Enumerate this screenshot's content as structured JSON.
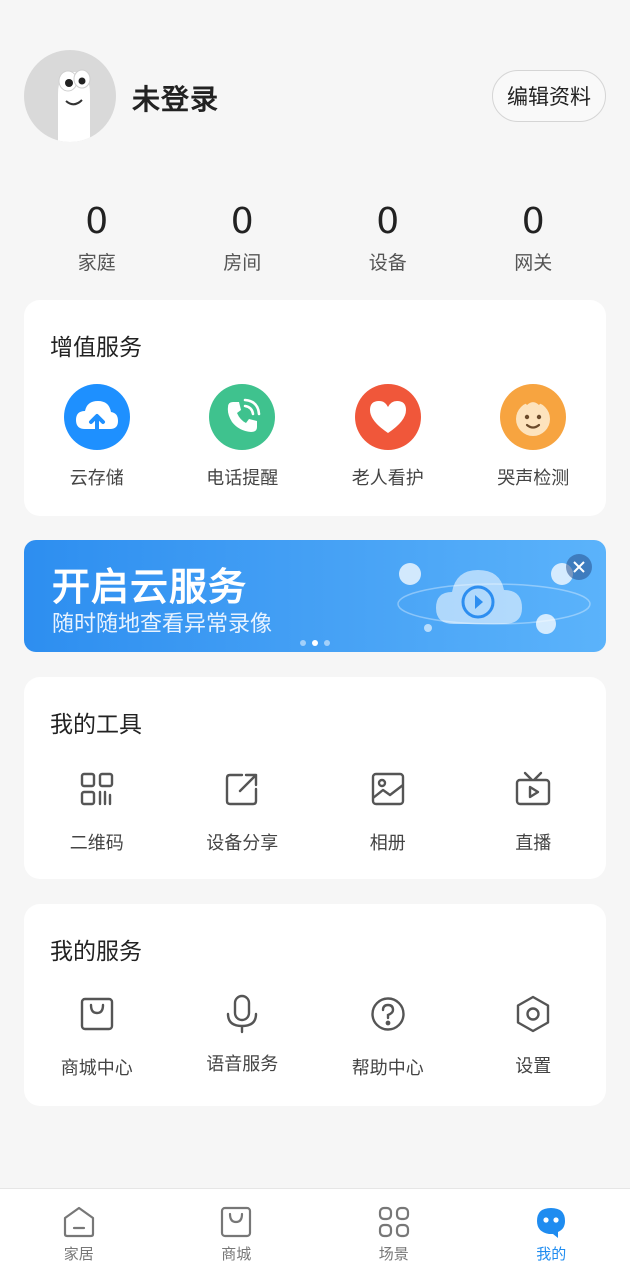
{
  "profile": {
    "username": "未登录",
    "edit_label": "编辑资料",
    "avatar_icon": "ghost-avatar-icon"
  },
  "stats": [
    {
      "value": "0",
      "label": "家庭"
    },
    {
      "value": "0",
      "label": "房间"
    },
    {
      "value": "0",
      "label": "设备"
    },
    {
      "value": "0",
      "label": "网关"
    }
  ],
  "value_services": {
    "title": "增值服务",
    "items": [
      {
        "label": "云存储",
        "icon": "cloud-upload-icon",
        "color": "#1e90ff"
      },
      {
        "label": "电话提醒",
        "icon": "phone-icon",
        "color": "#3fc28e"
      },
      {
        "label": "老人看护",
        "icon": "heart-icon",
        "color": "#f0573a"
      },
      {
        "label": "哭声检测",
        "icon": "baby-face-icon",
        "color": "#f7a440"
      }
    ]
  },
  "banner": {
    "title": "开启云服务",
    "subtitle": "随时随地查看异常录像",
    "accent": "#2d8ef0"
  },
  "tools": {
    "title": "我的工具",
    "items": [
      {
        "label": "二维码",
        "icon": "qrcode-icon"
      },
      {
        "label": "设备分享",
        "icon": "share-icon"
      },
      {
        "label": "相册",
        "icon": "album-icon"
      },
      {
        "label": "直播",
        "icon": "live-tv-icon"
      }
    ]
  },
  "services": {
    "title": "我的服务",
    "items": [
      {
        "label": "商城中心",
        "icon": "shopping-bag-icon"
      },
      {
        "label": "语音服务",
        "icon": "microphone-icon"
      },
      {
        "label": "帮助中心",
        "icon": "help-icon"
      },
      {
        "label": "设置",
        "icon": "settings-hexagon-icon"
      }
    ]
  },
  "tabbar": {
    "active_color": "#1f8cf0",
    "items": [
      {
        "label": "家居",
        "icon": "home-icon",
        "active": false
      },
      {
        "label": "商城",
        "icon": "shopping-bag-icon",
        "active": false
      },
      {
        "label": "场景",
        "icon": "grid-icon",
        "active": false
      },
      {
        "label": "我的",
        "icon": "mascot-icon",
        "active": true
      }
    ]
  }
}
